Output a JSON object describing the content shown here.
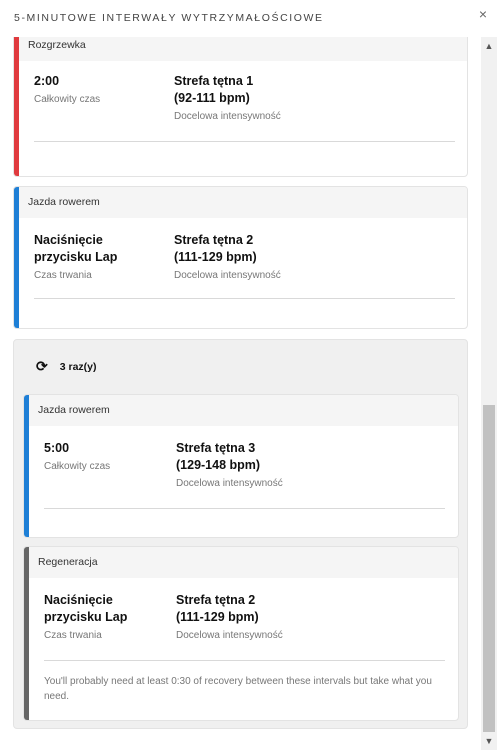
{
  "dialog": {
    "title": "5-MINUTOWE INTERWAŁY WYTRZYMAŁOŚCIOWE",
    "close_label": "×"
  },
  "colors": {
    "warmup": "#e03a3e",
    "bike": "#1e7fd6",
    "recovery": "#666666"
  },
  "steps": [
    {
      "type": "Rozgrzewka",
      "value": "2:00",
      "value_label": "Całkowity czas",
      "target_line1": "Strefa tętna 1",
      "target_line2": "(92-111 bpm)",
      "target_label": "Docelowa intensywność"
    },
    {
      "type": "Jazda rowerem",
      "value_line1": "Naciśnięcie",
      "value_line2": "przycisku Lap",
      "value_label": "Czas trwania",
      "target_line1": "Strefa tętna 2",
      "target_line2": "(111-129 bpm)",
      "target_label": "Docelowa intensywność"
    }
  ],
  "repeat": {
    "label": "3 raz(y)",
    "icon": "repeat-icon",
    "steps": [
      {
        "type": "Jazda rowerem",
        "value": "5:00",
        "value_label": "Całkowity czas",
        "target_line1": "Strefa tętna 3",
        "target_line2": "(129-148 bpm)",
        "target_label": "Docelowa intensywność"
      },
      {
        "type": "Regeneracja",
        "value_line1": "Naciśnięcie",
        "value_line2": "przycisku Lap",
        "value_label": "Czas trwania",
        "target_line1": "Strefa tętna 2",
        "target_line2": "(111-129 bpm)",
        "target_label": "Docelowa intensywność",
        "note": "You'll probably need at least 0:30 of recovery between these intervals but take what you need."
      }
    ]
  }
}
